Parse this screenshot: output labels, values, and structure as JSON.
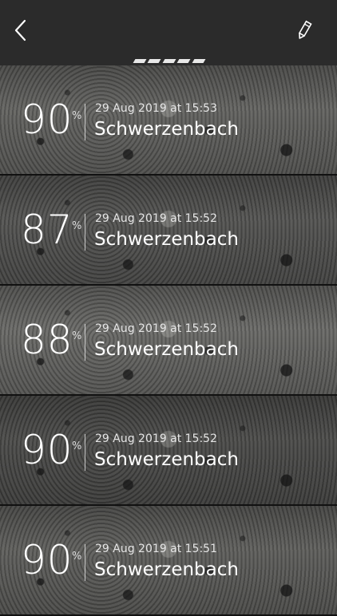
{
  "header": {
    "back_icon": "chevron-left-icon",
    "edit_icon": "pencil-icon",
    "page_indicator_count": 5
  },
  "measurements": [
    {
      "value": "90",
      "unit": "%",
      "timestamp": "29 Aug 2019 at 15:53",
      "location": "Schwerzenbach"
    },
    {
      "value": "87",
      "unit": "%",
      "timestamp": "29 Aug 2019 at 15:52",
      "location": "Schwerzenbach"
    },
    {
      "value": "88",
      "unit": "%",
      "timestamp": "29 Aug 2019 at 15:52",
      "location": "Schwerzenbach"
    },
    {
      "value": "90",
      "unit": "%",
      "timestamp": "29 Aug 2019 at 15:52",
      "location": "Schwerzenbach"
    },
    {
      "value": "90",
      "unit": "%",
      "timestamp": "29 Aug 2019 at 15:51",
      "location": "Schwerzenbach"
    }
  ],
  "colors": {
    "header_bg": "#2b2b2b",
    "text": "#ffffff",
    "indicator": "#e8e8e8"
  }
}
